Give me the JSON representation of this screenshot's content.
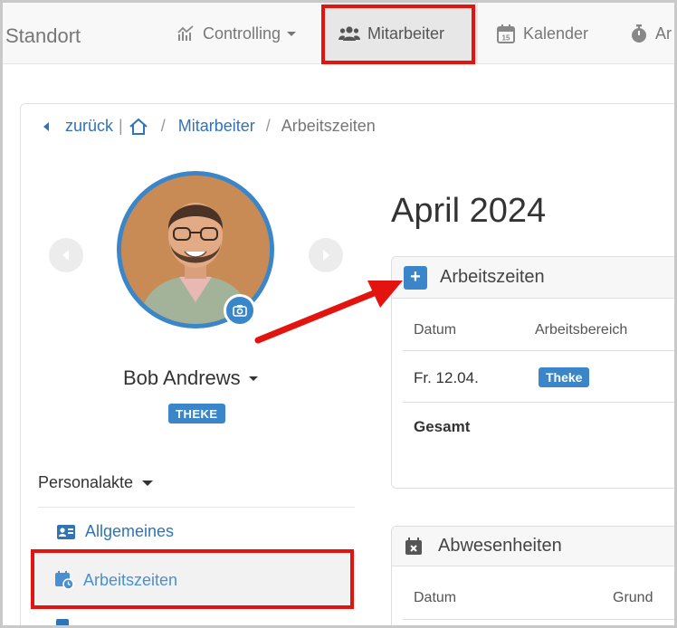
{
  "nav": {
    "brand": "Standort",
    "items": [
      {
        "label": "Controlling"
      },
      {
        "label": "Mitarbeiter"
      },
      {
        "label": "Kalender"
      },
      {
        "label": "Ar"
      }
    ]
  },
  "breadcrumb": {
    "back": "zurück",
    "sep1": "|",
    "sep2": "/",
    "mitarbeiter": "Mitarbeiter",
    "sep3": "/",
    "current": "Arbeitszeiten"
  },
  "profile": {
    "name": "Bob Andrews",
    "badge": "THEKE"
  },
  "sidebar": {
    "section": "Personalakte",
    "items": [
      {
        "label": "Allgemeines"
      },
      {
        "label": "Arbeitszeiten"
      }
    ]
  },
  "main": {
    "month": "April 2024",
    "arbeitszeiten": {
      "title": "Arbeitszeiten",
      "add": "+",
      "headers": [
        "Datum",
        "Arbeitsbereich"
      ],
      "rows": [
        {
          "datum": "Fr. 12.04.",
          "bereich": "Theke"
        }
      ],
      "total": "Gesamt"
    },
    "abwesenheiten": {
      "title": "Abwesenheiten",
      "headers": [
        "Datum",
        "Grund"
      ]
    }
  },
  "colors": {
    "accent": "#3a86c8",
    "link": "#2f74b5",
    "highlight": "#e3140f"
  }
}
